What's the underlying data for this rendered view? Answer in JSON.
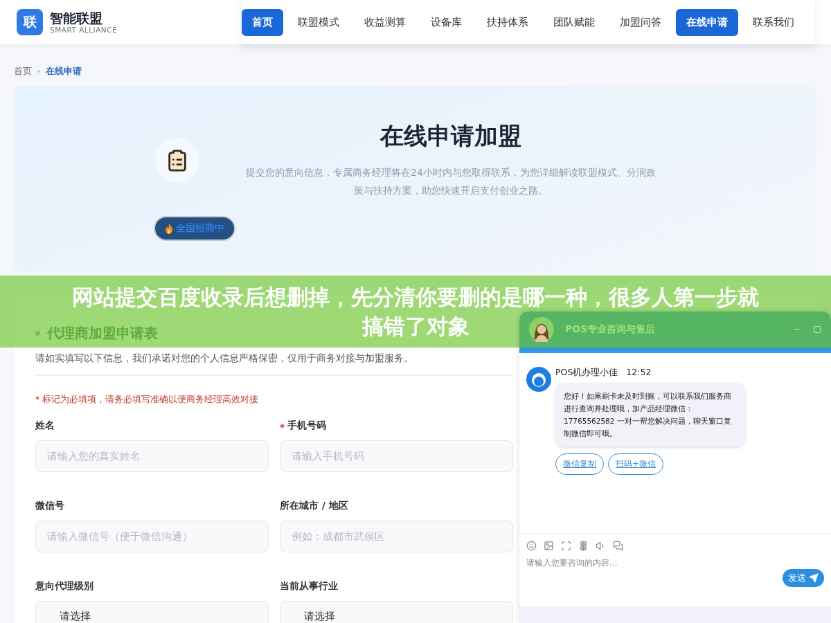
{
  "header": {
    "logo_mark": "联",
    "brand": "智能联盟",
    "tagline": "SMART ALLIANCE"
  },
  "nav": [
    {
      "label": "首页",
      "selected": true
    },
    {
      "label": "联盟模式",
      "selected": false
    },
    {
      "label": "收益测算",
      "selected": false
    },
    {
      "label": "设备库",
      "selected": false
    },
    {
      "label": "扶持体系",
      "selected": false
    },
    {
      "label": "团队赋能",
      "selected": false
    },
    {
      "label": "加盟问答",
      "selected": false
    },
    {
      "label": "在线申请",
      "selected": true
    },
    {
      "label": "联系我们",
      "selected": false
    }
  ],
  "breadcrumb": [
    {
      "label": "首页",
      "current": false
    },
    {
      "label": "在线申请",
      "current": true
    }
  ],
  "hero": {
    "title": "在线申请加盟",
    "subtitle": "提交您的意向信息，专属商务经理将在24小时内与您取得联系，为您详细解读联盟模式、分润政策与扶持方案，助您快速开启支付创业之路。",
    "badge": "全国招商中"
  },
  "banner": {
    "headline_lines": [
      "网站提交百度收录后想删掉，先分清你要删的是哪一种，很多人第一步就",
      "搞错了对象"
    ]
  },
  "form": {
    "title": "代理商加盟申请表",
    "intro": "请如实填写以下信息，我们承诺对您的个人信息严格保密，仅用于商务对接与加盟服务。",
    "required_note": "* 标记为必填项，请务必填写准确以便商务经理高效对接",
    "fields": [
      {
        "label": "姓名",
        "required": false,
        "kind": "input",
        "placeholder": "请输入您的真实姓名"
      },
      {
        "label": "手机号码",
        "required": true,
        "kind": "input",
        "placeholder": "请输入手机号码"
      },
      {
        "label": "微信号",
        "required": false,
        "kind": "input",
        "placeholder": "请输入微信号（便于微信沟通）"
      },
      {
        "label": "所在城市 / 地区",
        "required": false,
        "kind": "input",
        "placeholder": "例如：成都市武侯区"
      },
      {
        "label": "意向代理级别",
        "required": false,
        "kind": "select",
        "value": "请选择"
      },
      {
        "label": "当前从事行业",
        "required": false,
        "kind": "select",
        "value": "请选择"
      }
    ]
  },
  "chat": {
    "title": "POS专业咨询与售后",
    "agent": "POS机办理小佳",
    "time": "12:52",
    "message": "您好！如果刷卡未及时到账，可以联系我们服务商进行查询并处理哦，加产品经理微信：17765562582 一对一帮您解决问题，聊天窗口复制微信即可哦。",
    "actions": [
      "微信复制",
      "扫码+微信"
    ],
    "input_placeholder": "请输入您要咨询的内容...",
    "send": "发送"
  }
}
